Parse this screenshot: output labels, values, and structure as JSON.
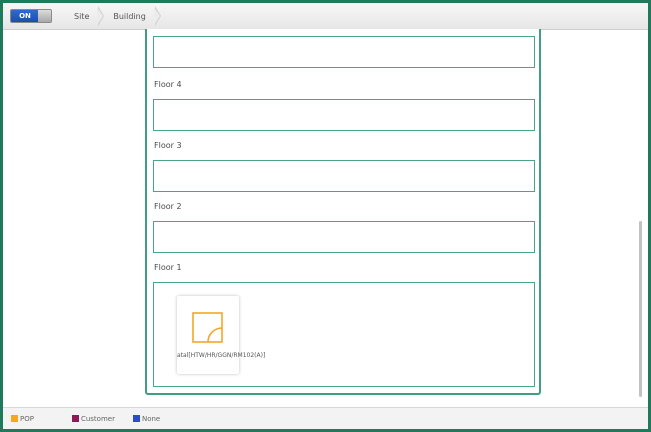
{
  "toolbar": {
    "toggle_label": "ON",
    "breadcrumbs": [
      "Site",
      "Building"
    ]
  },
  "floors": [
    {
      "label": "Floor 4"
    },
    {
      "label": "Floor 3"
    },
    {
      "label": "Floor 2"
    },
    {
      "label": "Floor 1"
    }
  ],
  "device": {
    "name": "atal[HTW/HR/GGN/RM102(A)]",
    "icon": "pop-device-icon",
    "color": "#f5a623"
  },
  "legend": [
    {
      "label": "POP",
      "color": "#f5a623"
    },
    {
      "label": "Customer",
      "color": "#8b1a5a"
    },
    {
      "label": "None",
      "color": "#2a4fc4"
    }
  ],
  "colors": {
    "frame": "#1f7a5c",
    "panel_border": "#3f9f7c",
    "toggle_on": "#2f6ad0"
  }
}
